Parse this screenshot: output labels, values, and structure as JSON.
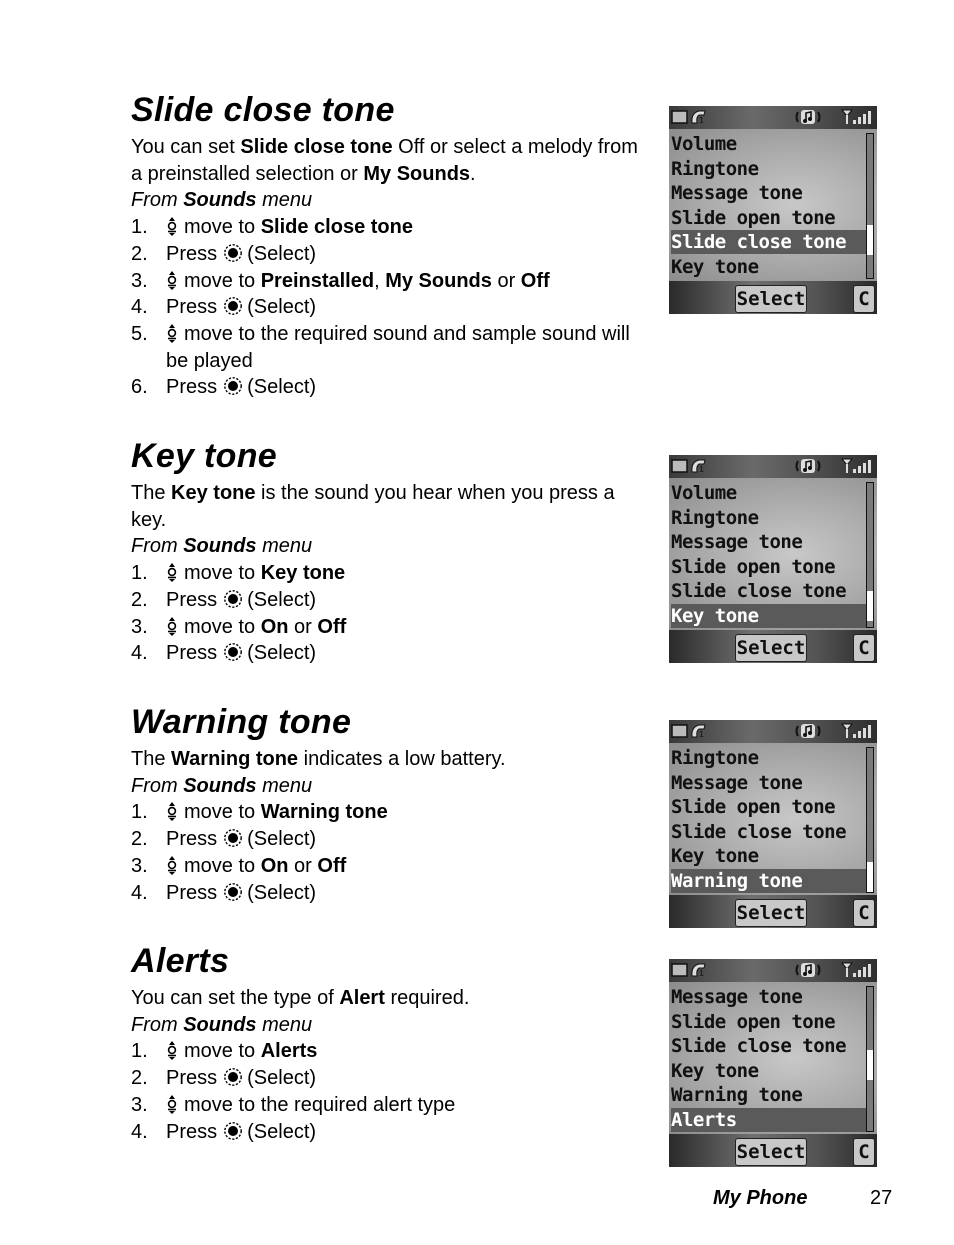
{
  "sections": [
    {
      "heading": "Slide close tone",
      "intro": [
        {
          "t": "You can set ",
          "b": false
        },
        {
          "t": "Slide close tone",
          "b": true
        },
        {
          "t": " Off or select a melody from a preinstalled selection or ",
          "b": false
        },
        {
          "t": "My Sounds",
          "b": true
        },
        {
          "t": ".",
          "b": false
        }
      ],
      "from": {
        "pre": "From ",
        "menu": "Sounds",
        "post": " menu"
      },
      "steps": [
        {
          "num": "1.",
          "icon": "nav",
          "parts": [
            {
              "t": "move to ",
              "b": false
            },
            {
              "t": "Slide close tone",
              "b": true
            }
          ]
        },
        {
          "num": "2.",
          "icon": "select",
          "pre": "Press",
          "parts": [
            {
              "t": "(Select)",
              "b": false
            }
          ]
        },
        {
          "num": "3.",
          "icon": "nav",
          "parts": [
            {
              "t": "move to ",
              "b": false
            },
            {
              "t": "Preinstalled",
              "b": true
            },
            {
              "t": ", ",
              "b": false
            },
            {
              "t": "My Sounds",
              "b": true
            },
            {
              "t": " or ",
              "b": false
            },
            {
              "t": "Off",
              "b": true
            }
          ]
        },
        {
          "num": "4.",
          "icon": "select",
          "pre": "Press",
          "parts": [
            {
              "t": "(Select)",
              "b": false
            }
          ]
        },
        {
          "num": "5.",
          "icon": "nav",
          "parts": [
            {
              "t": "move to the required sound and sample sound will be played",
              "b": false
            }
          ]
        },
        {
          "num": "6.",
          "icon": "select",
          "pre": "Press",
          "parts": [
            {
              "t": "(Select)",
              "b": false
            }
          ]
        }
      ],
      "screen": {
        "items": [
          "Volume",
          "Ringtone",
          "Message tone",
          "Slide open tone",
          "Slide close tone",
          "Key tone"
        ],
        "highlighted": 4,
        "scroll_fraction": 0.8,
        "softkey": "Select",
        "clear_key": "C"
      }
    },
    {
      "heading": "Key tone",
      "intro": [
        {
          "t": "The ",
          "b": false
        },
        {
          "t": "Key tone",
          "b": true
        },
        {
          "t": " is the sound you hear when you press a key.",
          "b": false
        }
      ],
      "from": {
        "pre": "From ",
        "menu": "Sounds",
        "post": " menu"
      },
      "steps": [
        {
          "num": "1.",
          "icon": "nav",
          "parts": [
            {
              "t": "move to ",
              "b": false
            },
            {
              "t": "Key tone",
              "b": true
            }
          ]
        },
        {
          "num": "2.",
          "icon": "select",
          "pre": "Press",
          "parts": [
            {
              "t": "(Select)",
              "b": false
            }
          ]
        },
        {
          "num": "3.",
          "icon": "nav",
          "parts": [
            {
              "t": "move to ",
              "b": false
            },
            {
              "t": "On",
              "b": true
            },
            {
              "t": " or ",
              "b": false
            },
            {
              "t": "Off",
              "b": true
            }
          ]
        },
        {
          "num": "4.",
          "icon": "select",
          "pre": "Press",
          "parts": [
            {
              "t": "(Select)",
              "b": false
            }
          ]
        }
      ],
      "screen": {
        "items": [
          "Volume",
          "Ringtone",
          "Message tone",
          "Slide open tone",
          "Slide close tone",
          "Key tone"
        ],
        "highlighted": 5,
        "scroll_fraction": 0.95,
        "softkey": "Select",
        "clear_key": "C"
      }
    },
    {
      "heading": "Warning tone",
      "intro": [
        {
          "t": "The ",
          "b": false
        },
        {
          "t": "Warning tone",
          "b": true
        },
        {
          "t": " indicates a low battery.",
          "b": false
        }
      ],
      "from": {
        "pre": "From ",
        "menu": "Sounds",
        "post": " menu"
      },
      "steps": [
        {
          "num": "1.",
          "icon": "nav",
          "parts": [
            {
              "t": "move to ",
              "b": false
            },
            {
              "t": "Warning tone",
              "b": true
            }
          ]
        },
        {
          "num": "2.",
          "icon": "select",
          "pre": "Press",
          "parts": [
            {
              "t": "(Select)",
              "b": false
            }
          ]
        },
        {
          "num": "3.",
          "icon": "nav",
          "parts": [
            {
              "t": "move to ",
              "b": false
            },
            {
              "t": "On",
              "b": true
            },
            {
              "t": " or ",
              "b": false
            },
            {
              "t": "Off",
              "b": true
            }
          ]
        },
        {
          "num": "4.",
          "icon": "select",
          "pre": "Press",
          "parts": [
            {
              "t": "(Select)",
              "b": false
            }
          ]
        }
      ],
      "screen": {
        "items": [
          "Ringtone",
          "Message tone",
          "Slide open tone",
          "Slide close tone",
          "Key tone",
          "Warning tone"
        ],
        "highlighted": 5,
        "scroll_fraction": 1.0,
        "softkey": "Select",
        "clear_key": "C"
      }
    },
    {
      "heading": "Alerts",
      "intro": [
        {
          "t": "You can set the type of ",
          "b": false
        },
        {
          "t": "Alert",
          "b": true
        },
        {
          "t": " required.",
          "b": false
        }
      ],
      "from": {
        "pre": "From ",
        "menu": "Sounds",
        "post": " menu"
      },
      "steps": [
        {
          "num": "1.",
          "icon": "nav",
          "parts": [
            {
              "t": "move to ",
              "b": false
            },
            {
              "t": "Alerts",
              "b": true
            }
          ]
        },
        {
          "num": "2.",
          "icon": "select",
          "pre": "Press",
          "parts": [
            {
              "t": "(Select)",
              "b": false
            }
          ]
        },
        {
          "num": "3.",
          "icon": "nav",
          "parts": [
            {
              "t": "move to the required alert type",
              "b": false
            }
          ]
        },
        {
          "num": "4.",
          "icon": "select",
          "pre": "Press",
          "parts": [
            {
              "t": "(Select)",
              "b": false
            }
          ]
        }
      ],
      "screen": {
        "items": [
          "Message tone",
          "Slide open tone",
          "Slide close tone",
          "Key tone",
          "Warning tone",
          "Alerts"
        ],
        "highlighted": 5,
        "scroll_fraction": 0.55,
        "softkey": "Select",
        "clear_key": "C"
      }
    }
  ],
  "status_icons": [
    "battery-icon",
    "line1-icon",
    "ringer-music-icon",
    "signal-strength-icon"
  ],
  "footer": {
    "title": "My Phone",
    "page": "27"
  }
}
